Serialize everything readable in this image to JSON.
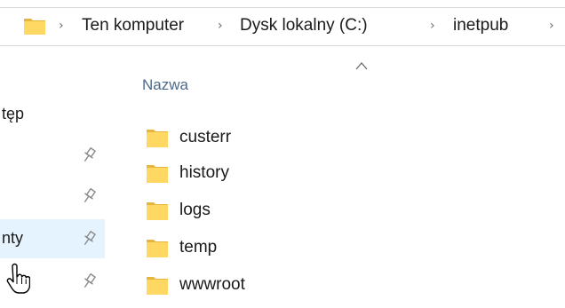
{
  "address_bar": {
    "crumbs": [
      "Ten komputer",
      "Dysk lokalny (C:)",
      "inetpub"
    ],
    "separator": ">"
  },
  "nav_pane": {
    "items": [
      {
        "label": "tęp",
        "pinned": false
      },
      {
        "label": "",
        "pinned": true
      },
      {
        "label": "",
        "pinned": true
      },
      {
        "label": "nty",
        "pinned": true,
        "hovered": true
      },
      {
        "label": "",
        "pinned": true
      }
    ]
  },
  "file_list": {
    "column_header": "Nazwa",
    "sort": "ascending",
    "items": [
      {
        "name": "custerr",
        "icon": "folder-icon"
      },
      {
        "name": "history",
        "icon": "folder-icon"
      },
      {
        "name": "logs",
        "icon": "folder-icon"
      },
      {
        "name": "temp",
        "icon": "folder-icon"
      },
      {
        "name": "wwwroot",
        "icon": "folder-icon"
      }
    ]
  },
  "colors": {
    "folder_body": "#ffd863",
    "folder_tab": "#e6b53e",
    "hover_bg": "#e5f3ff",
    "header_text": "#4d6a8a"
  }
}
